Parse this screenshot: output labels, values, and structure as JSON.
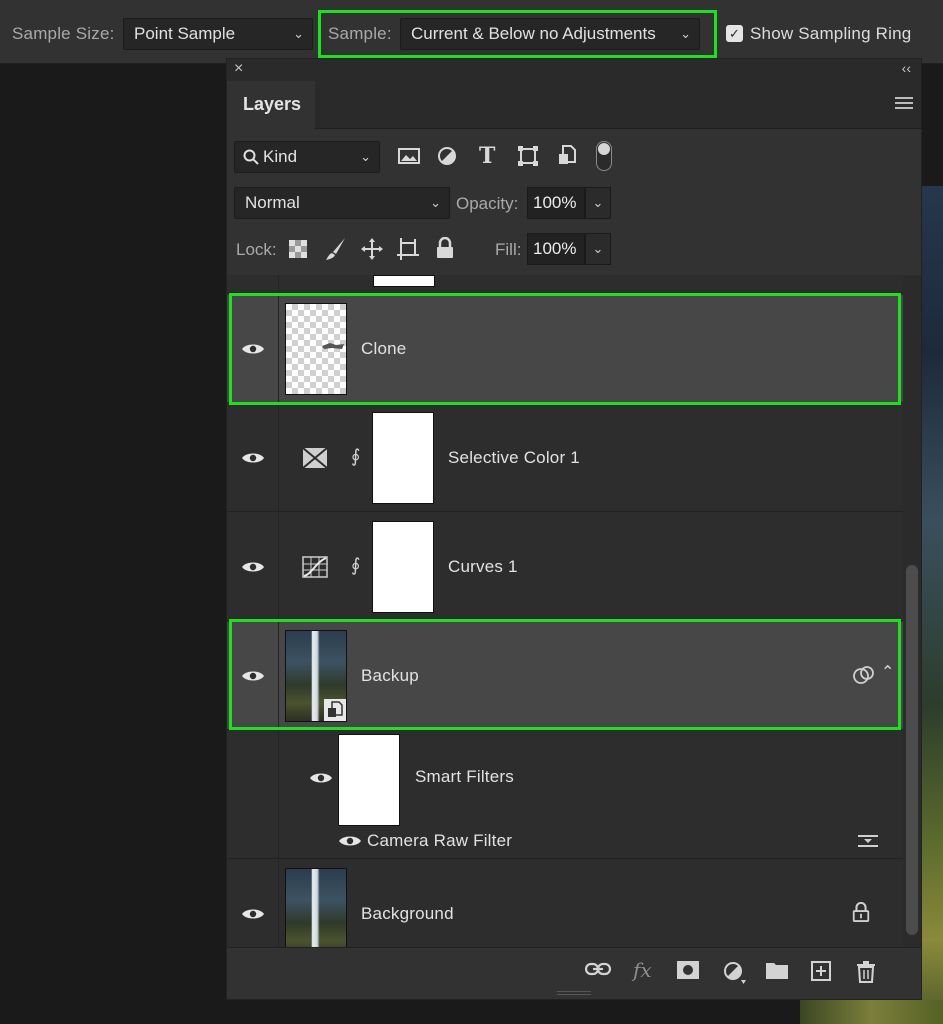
{
  "options_bar": {
    "sample_size_label": "Sample Size:",
    "sample_size_value": "Point Sample",
    "sample_label": "Sample:",
    "sample_value": "Current & Below no Adjustments",
    "show_sampling_ring_label": "Show Sampling Ring",
    "show_sampling_ring_checked": true
  },
  "panel": {
    "tab_label": "Layers",
    "filter_kind": "Kind",
    "filter_icons": [
      "image-icon",
      "adjustment-icon",
      "type-icon",
      "shape-icon",
      "smart-object-icon"
    ],
    "blend_mode": "Normal",
    "opacity_label": "Opacity:",
    "opacity_value": "100%",
    "lock_label": "Lock:",
    "lock_icons": [
      "lock-transparent-icon",
      "lock-paint-icon",
      "lock-position-icon",
      "lock-artboard-icon",
      "lock-all-icon"
    ],
    "fill_label": "Fill:",
    "fill_value": "100%"
  },
  "layers": [
    {
      "name": "Clone",
      "type": "pixel",
      "visible": true,
      "selected": true
    },
    {
      "name": "Selective Color 1",
      "type": "adjustment-selective-color",
      "visible": true,
      "selected": false
    },
    {
      "name": "Curves 1",
      "type": "adjustment-curves",
      "visible": true,
      "selected": false
    },
    {
      "name": "Backup",
      "type": "smart-object",
      "visible": true,
      "selected": true
    },
    {
      "name": "Smart Filters",
      "type": "smart-filters",
      "visible": true,
      "selected": false
    },
    {
      "name": "Camera Raw Filter",
      "type": "filter",
      "visible": true,
      "selected": false
    },
    {
      "name": "Background",
      "type": "background",
      "visible": true,
      "selected": false,
      "locked": true
    }
  ],
  "bottom_icons": [
    "link-layers-icon",
    "fx-icon",
    "add-mask-icon",
    "new-adjustment-icon",
    "new-group-icon",
    "new-layer-icon",
    "delete-icon"
  ],
  "colors": {
    "highlight": "#19e419",
    "panel_bg": "#323232",
    "selected_row": "#474747"
  }
}
